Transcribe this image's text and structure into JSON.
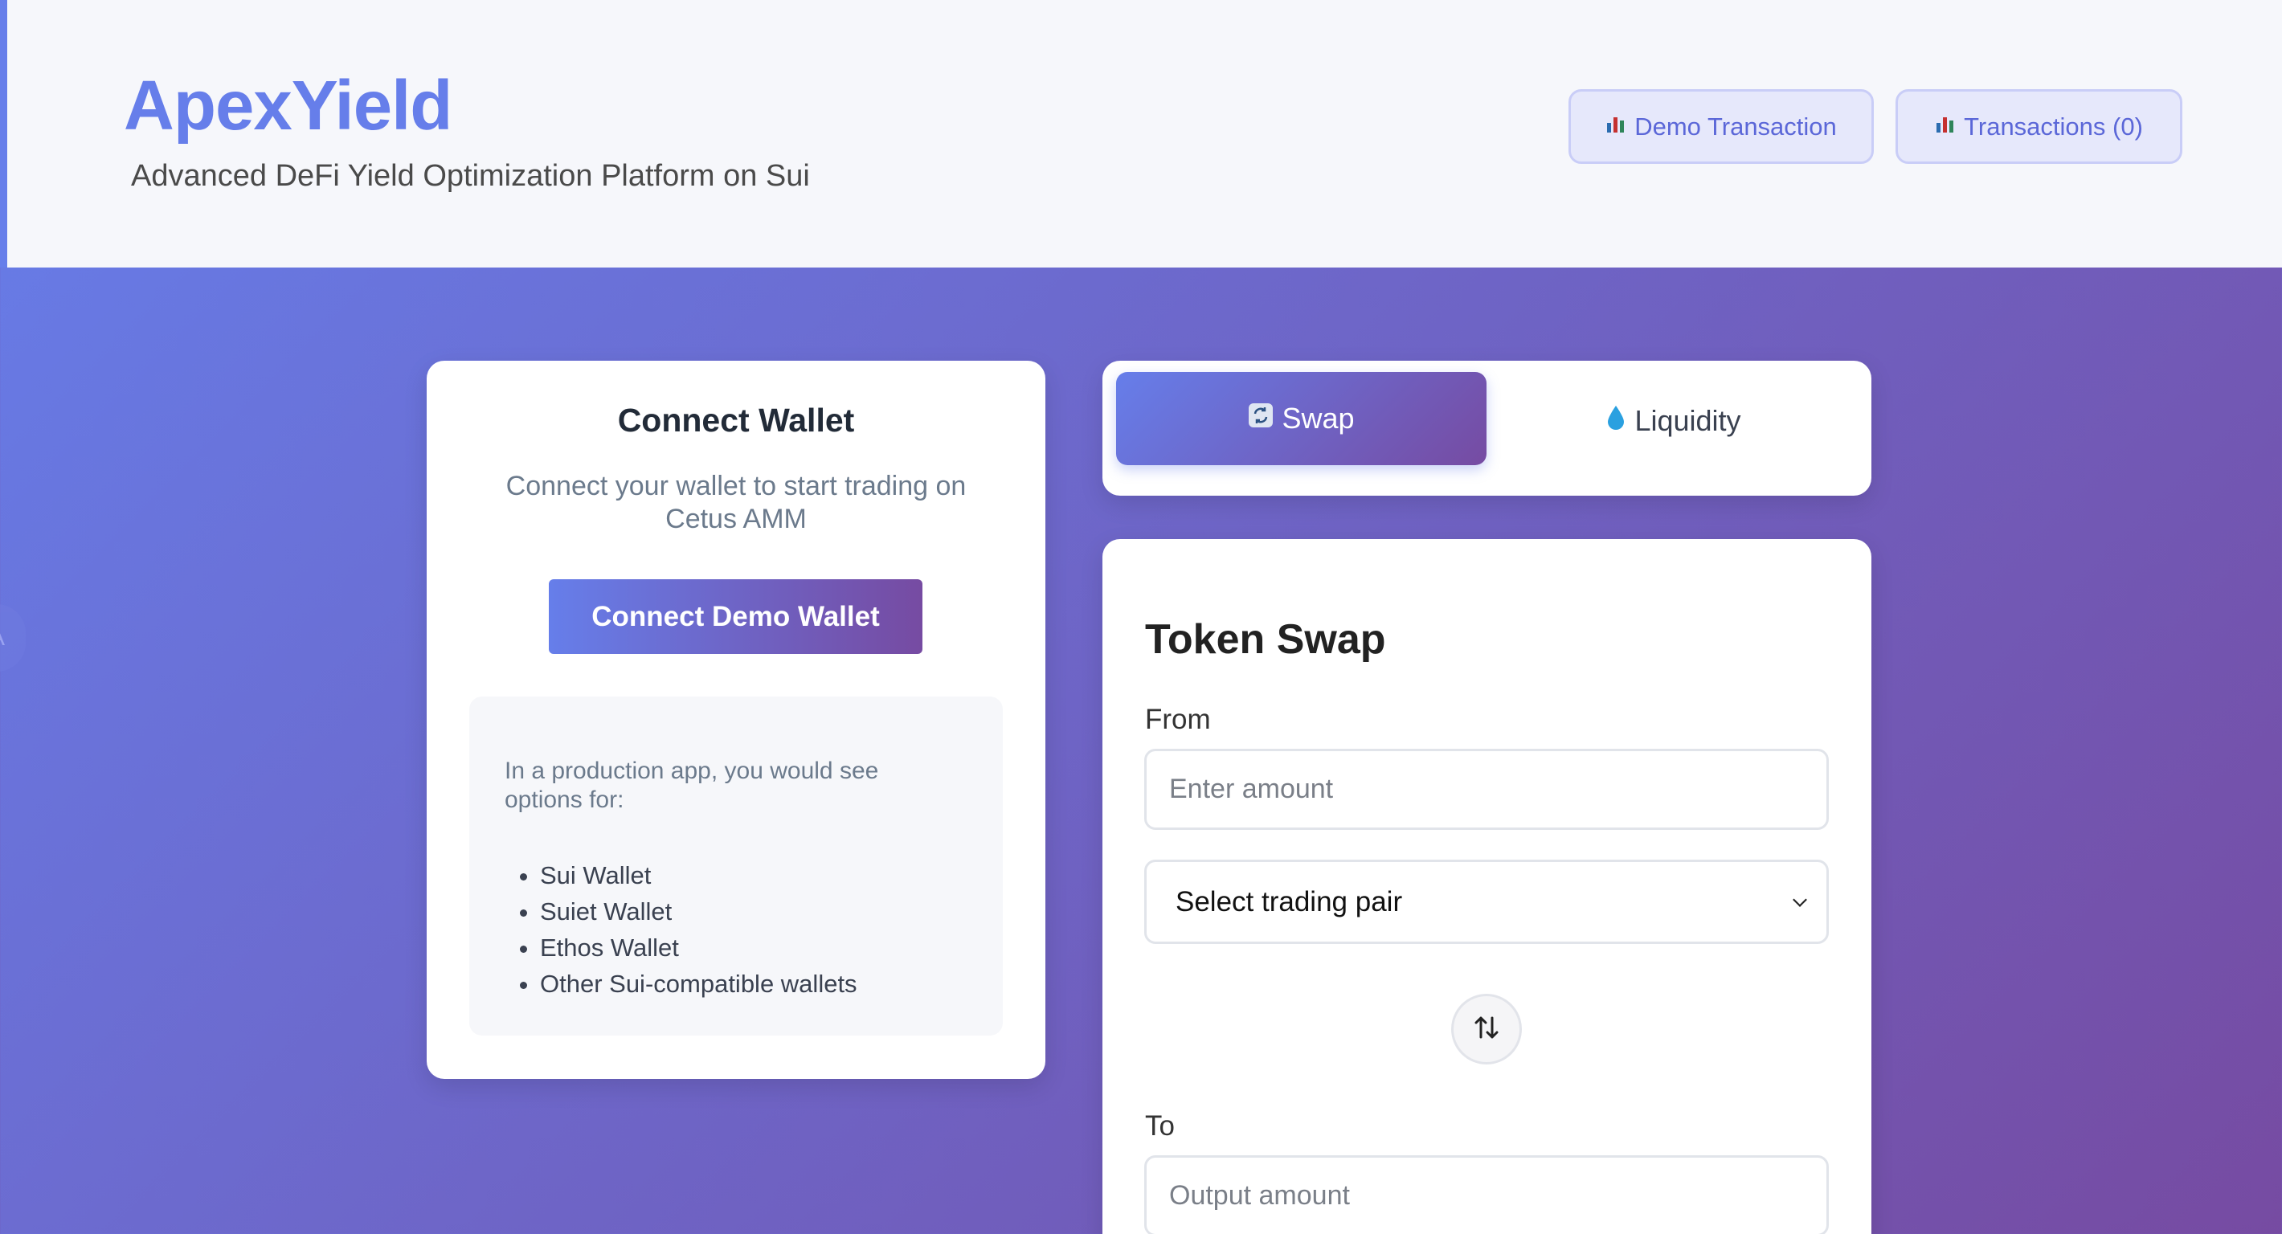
{
  "header": {
    "brand": "ApexYield",
    "subtitle": "Advanced DeFi Yield Optimization Platform on Sui",
    "demo_transaction_label": "Demo Transaction",
    "transactions_label": "Transactions (0)",
    "icon": "bar-chart-icon"
  },
  "edge_tab": {
    "label": "A"
  },
  "wallet": {
    "title": "Connect Wallet",
    "description": "Connect your wallet to start trading on Cetus AMM",
    "connect_label": "Connect Demo Wallet",
    "info_text": "In a production app, you would see options for:",
    "options": [
      "Sui Wallet",
      "Suiet Wallet",
      "Ethos Wallet",
      "Other Sui-compatible wallets"
    ]
  },
  "tabs": {
    "swap_label": "Swap",
    "swap_icon": "refresh-icon",
    "liquidity_label": "Liquidity",
    "liquidity_icon": "droplet-icon"
  },
  "swap": {
    "title": "Token Swap",
    "from_label": "From",
    "from_placeholder": "Enter amount",
    "pair_selected": "Select trading pair",
    "to_label": "To",
    "to_placeholder": "Output amount"
  },
  "colors": {
    "accent": "#667eea",
    "accent_end": "#764ba2"
  }
}
